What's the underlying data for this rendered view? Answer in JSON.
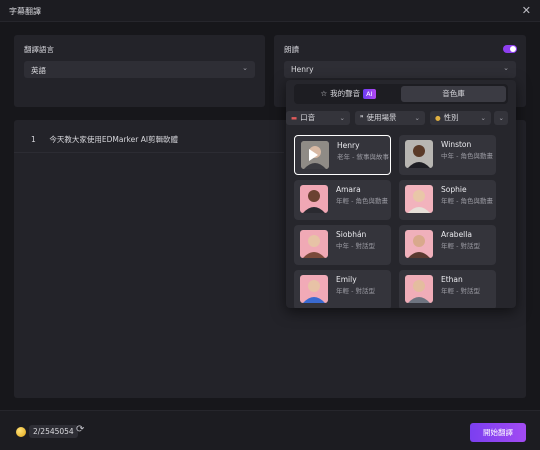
{
  "window": {
    "title": "字幕翻譯",
    "close_icon": "close-icon"
  },
  "translate_lang": {
    "label": "翻譯語言",
    "value": "英語"
  },
  "dubbing": {
    "label": "朗讀",
    "enabled": true,
    "voice": "Henry"
  },
  "subtitles": [
    {
      "index": "1",
      "text": "今天教大家使用EDMarker AI剪輯軟體"
    }
  ],
  "popup": {
    "tabs": [
      {
        "label": "我的聲音",
        "badge": "AI"
      },
      {
        "label": "音色庫"
      }
    ],
    "filters": [
      {
        "label": "口音",
        "icon": "flag-icon"
      },
      {
        "label": "使用場景",
        "icon": "quote-icon"
      },
      {
        "label": "性別",
        "icon": "person-icon"
      }
    ],
    "voices": [
      {
        "name": "Henry",
        "desc": "老年 - 敘事與故事",
        "selected": true
      },
      {
        "name": "Winston",
        "desc": "中年 - 角色與動畫"
      },
      {
        "name": "Amara",
        "desc": "年輕 - 角色與動畫"
      },
      {
        "name": "Sophie",
        "desc": "年輕 - 角色與動畫"
      },
      {
        "name": "Siobhán",
        "desc": "中年 - 對話型"
      },
      {
        "name": "Arabella",
        "desc": "年輕 - 對話型"
      },
      {
        "name": "Emily",
        "desc": "年輕 - 對話型"
      },
      {
        "name": "Ethan",
        "desc": "年輕 - 對話型"
      }
    ]
  },
  "footer": {
    "credits": "2/2545054",
    "start_label": "開始翻譯"
  },
  "colors": {
    "accent": "#8e3ff0",
    "background": "#17171b",
    "panel": "#232329"
  }
}
